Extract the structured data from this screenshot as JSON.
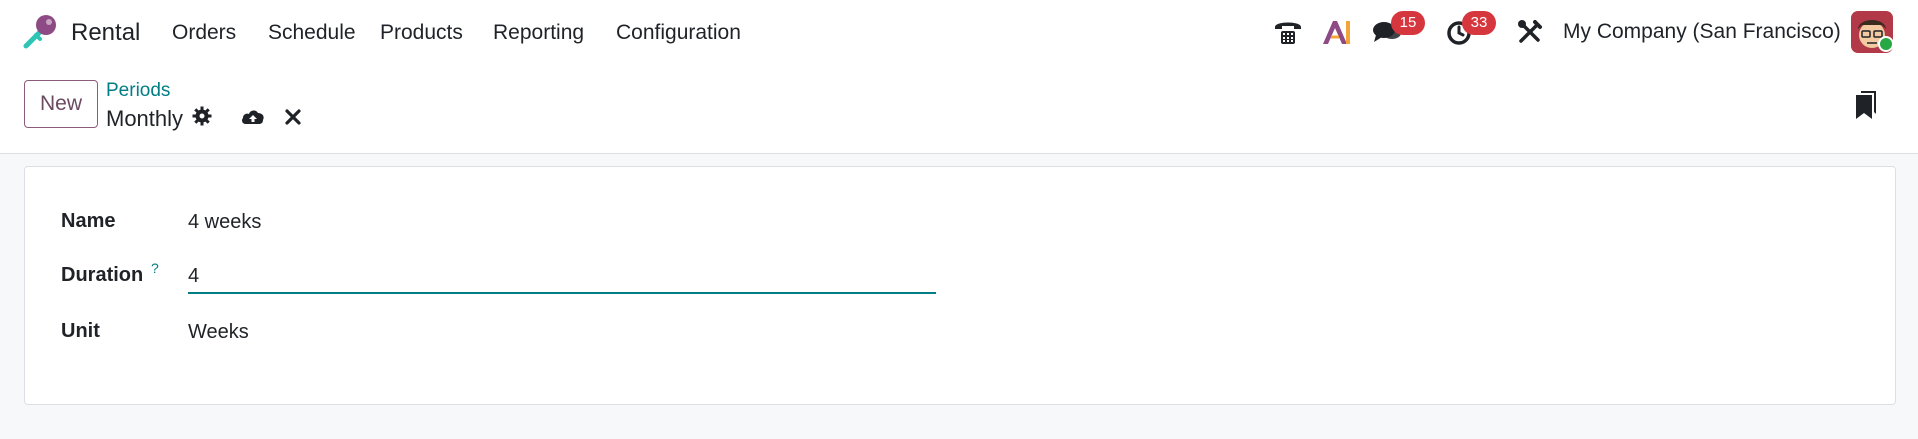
{
  "app": {
    "name": "Rental"
  },
  "menu": [
    "Orders",
    "Schedule",
    "Products",
    "Reporting",
    "Configuration"
  ],
  "systray": {
    "messages_count": "15",
    "activities_count": "33",
    "company": "My Company (San Francisco)",
    "icons": [
      "phone-icon",
      "ai-icon",
      "chat-icon",
      "clock-icon",
      "tools-icon"
    ]
  },
  "control_panel": {
    "new_label": "New",
    "breadcrumb_parent": "Periods",
    "record_title": "Monthly"
  },
  "form": {
    "name_label": "Name",
    "name_value": "4 weeks",
    "duration_label": "Duration",
    "duration_help": "?",
    "duration_value": "4",
    "unit_label": "Unit",
    "unit_value": "Weeks"
  },
  "colors": {
    "accent": "#017e84",
    "brand": "#714b67",
    "badge": "#d6373f"
  }
}
